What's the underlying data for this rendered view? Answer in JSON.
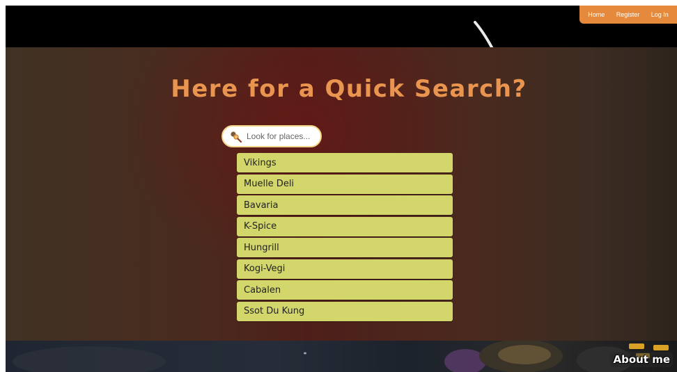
{
  "nav": {
    "links": [
      {
        "label": "Home"
      },
      {
        "label": "Register"
      },
      {
        "label": "Log In"
      }
    ]
  },
  "hero": {
    "title": "Here for a Quick Search?"
  },
  "search": {
    "placeholder": "Look for places...",
    "value": "",
    "icon": "search-icon"
  },
  "results": [
    {
      "label": "Vikings"
    },
    {
      "label": "Muelle Deli"
    },
    {
      "label": "Bavaria"
    },
    {
      "label": "K-Spice"
    },
    {
      "label": "Hungrill"
    },
    {
      "label": "Kogi-Vegi"
    },
    {
      "label": "Cabalen"
    },
    {
      "label": "Ssot Du Kung"
    }
  ],
  "footer": {
    "about_label": "About me"
  },
  "colors": {
    "accent_orange": "#e58a3c",
    "title_orange": "#e99550",
    "result_bg": "#d2d66b",
    "search_border": "#f2d58b"
  }
}
